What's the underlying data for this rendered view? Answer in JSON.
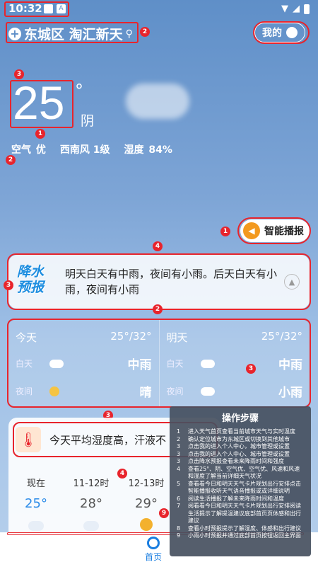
{
  "status_bar": {
    "time": "10:32",
    "badge": "A"
  },
  "location": {
    "name": "东城区 淘汇新天"
  },
  "header": {
    "my_label": "我的"
  },
  "current": {
    "temp": "25",
    "degree": "°",
    "condition": "阴"
  },
  "air": {
    "label": "空气",
    "quality": "优",
    "wind": "西南风 1级",
    "humidity_label": "湿度",
    "humidity": "84%"
  },
  "broadcast": {
    "label": "智能播报"
  },
  "precip": {
    "logo_line1": "降水",
    "logo_line2": "预报",
    "text": "明天白天有中雨，夜间有小雨。后天白天有小雨，夜间有小雨"
  },
  "days": [
    {
      "name": "今天",
      "range": "25°/32°",
      "day_label": "白天",
      "day_value": "中雨",
      "night_label": "夜间",
      "night_value": "晴"
    },
    {
      "name": "明天",
      "range": "25°/32°",
      "day_label": "白天",
      "day_value": "中雨",
      "night_label": "夜间",
      "night_value": "小雨"
    }
  ],
  "tip": {
    "badge": "提热",
    "text": "今天平均湿度高，汗液不"
  },
  "hourly": [
    {
      "time": "现在",
      "temp": "25°",
      "icon": "cloud"
    },
    {
      "time": "11-12时",
      "temp": "28°",
      "icon": "cloud"
    },
    {
      "time": "12-13时",
      "temp": "29°",
      "icon": "sun"
    }
  ],
  "tabbar": {
    "home_label": "首页"
  },
  "steps": {
    "title": "操作步骤",
    "items": [
      "进入天气首页查看当前城市天气与实时温度",
      "确认定位城市为东城区或切换到其他城市",
      "点击我的进入个人中心，城市管理或设置",
      "点击我的进入个人中心、城市管理或设置",
      "点击降水预报查看未来降雨时间和强度",
      "查看25°、阴、空气优、空气优、风速和风速和湿度了解当前详细天气状况",
      "查看看今日和明天天气卡片规划出行安排点击智能播报收听天气语音播报或或详细说明",
      "阅读生活播报了解未来降雨时间和温度",
      "阅看看今日和明天天气卡片规划出行安排阅读生活提示了解提温建议底部首页页体感和出行建议",
      "查看小时预报提示了解湿度、体感和出行建议",
      "小雨小时预报并通过底部首页按钮返回主界面"
    ]
  },
  "colors": {
    "accent": "#e8242c",
    "brand": "#1a7ee0",
    "orange": "#f39a1f"
  }
}
